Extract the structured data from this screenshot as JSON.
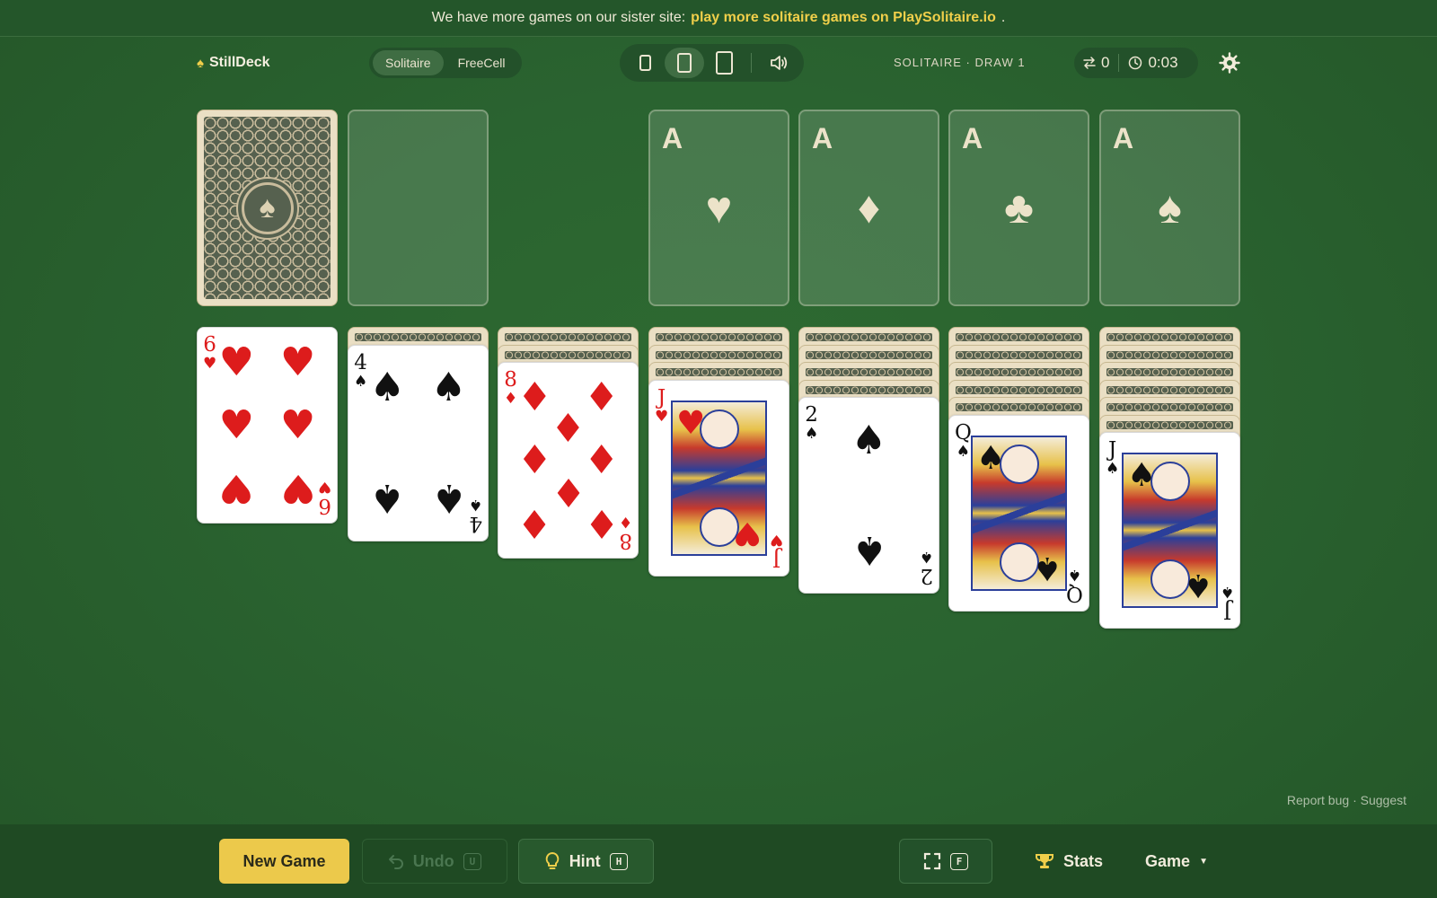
{
  "banner": {
    "text_before": "We have more games on our sister site:",
    "link": "play more solitaire games on PlaySolitaire.io",
    "text_after": "."
  },
  "header": {
    "brand": "StillDeck",
    "brand_icon": "spade-icon",
    "modes": [
      "Solitaire",
      "FreeCell"
    ],
    "active_mode": "Solitaire",
    "card_sizes": [
      "small",
      "medium",
      "large"
    ],
    "active_card_size": "medium",
    "sound_icon": "speaker-icon",
    "game_label": "SOLITAIRE · DRAW 1",
    "moves": "0",
    "moves_icon": "swap-arrows-icon",
    "time": "0:03",
    "time_icon": "clock-icon",
    "settings_icon": "gear-icon"
  },
  "stock": {
    "face_down": true,
    "emblem": "♠"
  },
  "waste": {
    "empty": true
  },
  "foundations": [
    {
      "label": "A",
      "suit": "♥"
    },
    {
      "label": "A",
      "suit": "♦"
    },
    {
      "label": "A",
      "suit": "♣"
    },
    {
      "label": "A",
      "suit": "♠"
    }
  ],
  "tableau": [
    {
      "hidden": 0,
      "card": {
        "rank": "6",
        "suit": "♥",
        "color": "red"
      }
    },
    {
      "hidden": 1,
      "card": {
        "rank": "4",
        "suit": "♠",
        "color": "black"
      }
    },
    {
      "hidden": 2,
      "card": {
        "rank": "8",
        "suit": "♦",
        "color": "red"
      }
    },
    {
      "hidden": 3,
      "card": {
        "rank": "J",
        "suit": "♥",
        "color": "red"
      }
    },
    {
      "hidden": 4,
      "card": {
        "rank": "2",
        "suit": "♠",
        "color": "black"
      }
    },
    {
      "hidden": 5,
      "card": {
        "rank": "Q",
        "suit": "♠",
        "color": "black"
      }
    },
    {
      "hidden": 6,
      "card": {
        "rank": "J",
        "suit": "♠",
        "color": "black"
      }
    }
  ],
  "footer_links": {
    "report": "Report bug",
    "separator": "·",
    "suggest": "Suggest"
  },
  "bottom_bar": {
    "new_game": "New Game",
    "undo": "Undo",
    "undo_key": "U",
    "hint": "Hint",
    "hint_key": "H",
    "fullscreen_key": "F",
    "stats": "Stats",
    "game": "Game"
  },
  "colors": {
    "felt": "#2a6330",
    "accent": "#ecc94b",
    "red_suit": "#dd1c1c"
  }
}
